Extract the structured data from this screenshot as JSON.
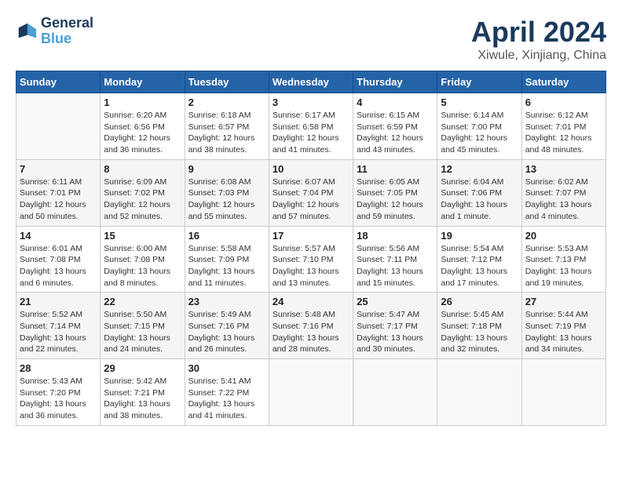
{
  "header": {
    "logo_line1": "General",
    "logo_line2": "Blue",
    "month": "April 2024",
    "location": "Xiwule, Xinjiang, China"
  },
  "columns": [
    "Sunday",
    "Monday",
    "Tuesday",
    "Wednesday",
    "Thursday",
    "Friday",
    "Saturday"
  ],
  "weeks": [
    [
      {
        "num": "",
        "info": ""
      },
      {
        "num": "1",
        "info": "Sunrise: 6:20 AM\nSunset: 6:56 PM\nDaylight: 12 hours\nand 36 minutes."
      },
      {
        "num": "2",
        "info": "Sunrise: 6:18 AM\nSunset: 6:57 PM\nDaylight: 12 hours\nand 38 minutes."
      },
      {
        "num": "3",
        "info": "Sunrise: 6:17 AM\nSunset: 6:58 PM\nDaylight: 12 hours\nand 41 minutes."
      },
      {
        "num": "4",
        "info": "Sunrise: 6:15 AM\nSunset: 6:59 PM\nDaylight: 12 hours\nand 43 minutes."
      },
      {
        "num": "5",
        "info": "Sunrise: 6:14 AM\nSunset: 7:00 PM\nDaylight: 12 hours\nand 45 minutes."
      },
      {
        "num": "6",
        "info": "Sunrise: 6:12 AM\nSunset: 7:01 PM\nDaylight: 12 hours\nand 48 minutes."
      }
    ],
    [
      {
        "num": "7",
        "info": "Sunrise: 6:11 AM\nSunset: 7:01 PM\nDaylight: 12 hours\nand 50 minutes."
      },
      {
        "num": "8",
        "info": "Sunrise: 6:09 AM\nSunset: 7:02 PM\nDaylight: 12 hours\nand 52 minutes."
      },
      {
        "num": "9",
        "info": "Sunrise: 6:08 AM\nSunset: 7:03 PM\nDaylight: 12 hours\nand 55 minutes."
      },
      {
        "num": "10",
        "info": "Sunrise: 6:07 AM\nSunset: 7:04 PM\nDaylight: 12 hours\nand 57 minutes."
      },
      {
        "num": "11",
        "info": "Sunrise: 6:05 AM\nSunset: 7:05 PM\nDaylight: 12 hours\nand 59 minutes."
      },
      {
        "num": "12",
        "info": "Sunrise: 6:04 AM\nSunset: 7:06 PM\nDaylight: 13 hours\nand 1 minute."
      },
      {
        "num": "13",
        "info": "Sunrise: 6:02 AM\nSunset: 7:07 PM\nDaylight: 13 hours\nand 4 minutes."
      }
    ],
    [
      {
        "num": "14",
        "info": "Sunrise: 6:01 AM\nSunset: 7:08 PM\nDaylight: 13 hours\nand 6 minutes."
      },
      {
        "num": "15",
        "info": "Sunrise: 6:00 AM\nSunset: 7:08 PM\nDaylight: 13 hours\nand 8 minutes."
      },
      {
        "num": "16",
        "info": "Sunrise: 5:58 AM\nSunset: 7:09 PM\nDaylight: 13 hours\nand 11 minutes."
      },
      {
        "num": "17",
        "info": "Sunrise: 5:57 AM\nSunset: 7:10 PM\nDaylight: 13 hours\nand 13 minutes."
      },
      {
        "num": "18",
        "info": "Sunrise: 5:56 AM\nSunset: 7:11 PM\nDaylight: 13 hours\nand 15 minutes."
      },
      {
        "num": "19",
        "info": "Sunrise: 5:54 AM\nSunset: 7:12 PM\nDaylight: 13 hours\nand 17 minutes."
      },
      {
        "num": "20",
        "info": "Sunrise: 5:53 AM\nSunset: 7:13 PM\nDaylight: 13 hours\nand 19 minutes."
      }
    ],
    [
      {
        "num": "21",
        "info": "Sunrise: 5:52 AM\nSunset: 7:14 PM\nDaylight: 13 hours\nand 22 minutes."
      },
      {
        "num": "22",
        "info": "Sunrise: 5:50 AM\nSunset: 7:15 PM\nDaylight: 13 hours\nand 24 minutes."
      },
      {
        "num": "23",
        "info": "Sunrise: 5:49 AM\nSunset: 7:16 PM\nDaylight: 13 hours\nand 26 minutes."
      },
      {
        "num": "24",
        "info": "Sunrise: 5:48 AM\nSunset: 7:16 PM\nDaylight: 13 hours\nand 28 minutes."
      },
      {
        "num": "25",
        "info": "Sunrise: 5:47 AM\nSunset: 7:17 PM\nDaylight: 13 hours\nand 30 minutes."
      },
      {
        "num": "26",
        "info": "Sunrise: 5:45 AM\nSunset: 7:18 PM\nDaylight: 13 hours\nand 32 minutes."
      },
      {
        "num": "27",
        "info": "Sunrise: 5:44 AM\nSunset: 7:19 PM\nDaylight: 13 hours\nand 34 minutes."
      }
    ],
    [
      {
        "num": "28",
        "info": "Sunrise: 5:43 AM\nSunset: 7:20 PM\nDaylight: 13 hours\nand 36 minutes."
      },
      {
        "num": "29",
        "info": "Sunrise: 5:42 AM\nSunset: 7:21 PM\nDaylight: 13 hours\nand 38 minutes."
      },
      {
        "num": "30",
        "info": "Sunrise: 5:41 AM\nSunset: 7:22 PM\nDaylight: 13 hours\nand 41 minutes."
      },
      {
        "num": "",
        "info": ""
      },
      {
        "num": "",
        "info": ""
      },
      {
        "num": "",
        "info": ""
      },
      {
        "num": "",
        "info": ""
      }
    ]
  ]
}
